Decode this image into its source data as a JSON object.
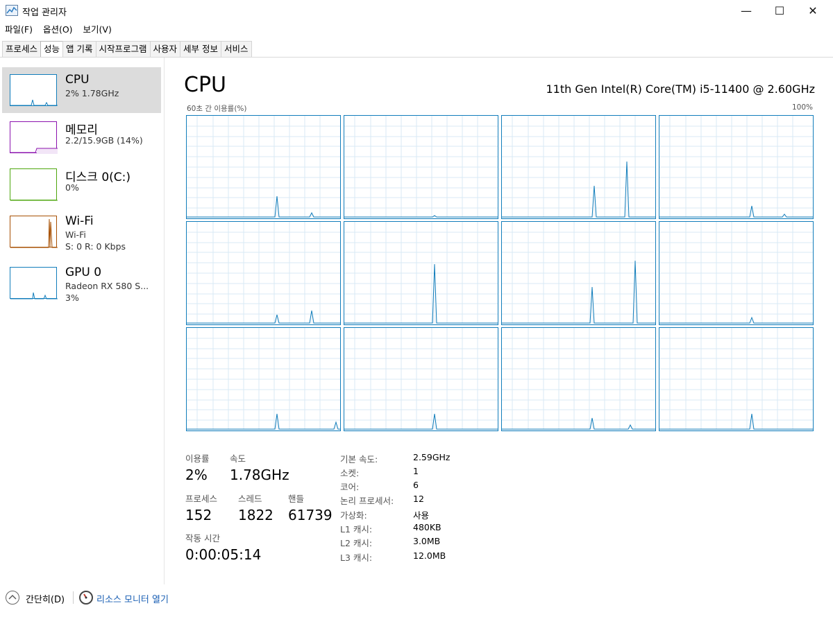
{
  "window": {
    "title": "작업 관리자",
    "minimize_glyph": "—",
    "maximize_glyph": "☐",
    "close_glyph": "✕"
  },
  "menu": [
    "파일(F)",
    "옵션(O)",
    "보기(V)"
  ],
  "tabs": [
    {
      "label": "프로세스",
      "active": false
    },
    {
      "label": "성능",
      "active": true
    },
    {
      "label": "앱 기록",
      "active": false
    },
    {
      "label": "시작프로그램",
      "active": false
    },
    {
      "label": "사용자",
      "active": false
    },
    {
      "label": "세부 정보",
      "active": false
    },
    {
      "label": "서비스",
      "active": false
    }
  ],
  "sidebar": [
    {
      "title": "CPU",
      "lines": [
        "2% 1.78GHz"
      ],
      "color": "#117dbb",
      "selected": true
    },
    {
      "title": "메모리",
      "lines": [
        "2.2/15.9GB (14%)"
      ],
      "color": "#8b12ae",
      "selected": false
    },
    {
      "title": "디스크 0(C:)",
      "lines": [
        "0%"
      ],
      "color": "#4da60c",
      "selected": false
    },
    {
      "title": "Wi-Fi",
      "lines": [
        "Wi-Fi",
        "S: 0 R: 0 Kbps"
      ],
      "color": "#a74f01",
      "selected": false
    },
    {
      "title": "GPU 0",
      "lines": [
        "Radeon RX 580 S...",
        "3%"
      ],
      "color": "#117dbb",
      "selected": false
    }
  ],
  "main": {
    "title": "CPU",
    "cpu_model": "11th Gen Intel(R) Core(TM) i5-11400 @ 2.60GHz",
    "graph_label": "60초 간 이용률(%)",
    "graph_max": "100%",
    "graph_color": "#117dbb",
    "grid_color": "#d9eaf4"
  },
  "stats": {
    "utilization_label": "이용률",
    "utilization_value": "2%",
    "speed_label": "속도",
    "speed_value": "1.78GHz",
    "processes_label": "프로세스",
    "processes_value": "152",
    "threads_label": "스레드",
    "threads_value": "1822",
    "handles_label": "핸들",
    "handles_value": "61739",
    "uptime_label": "작동 시간",
    "uptime_value": "0:00:05:14"
  },
  "details": [
    {
      "label": "기본 속도:",
      "value": "2.59GHz"
    },
    {
      "label": "소켓:",
      "value": "1"
    },
    {
      "label": "코어:",
      "value": "6"
    },
    {
      "label": "논리 프로세서:",
      "value": "12"
    },
    {
      "label": "가상화:",
      "value": "사용"
    },
    {
      "label": "L1 캐시:",
      "value": "480KB"
    },
    {
      "label": "L2 캐시:",
      "value": "3.0MB"
    },
    {
      "label": "L3 캐시:",
      "value": "12.0MB"
    }
  ],
  "footer": {
    "fewer_details": "간단히(D)",
    "resource_monitor": "리소스 모니터 열기"
  }
}
